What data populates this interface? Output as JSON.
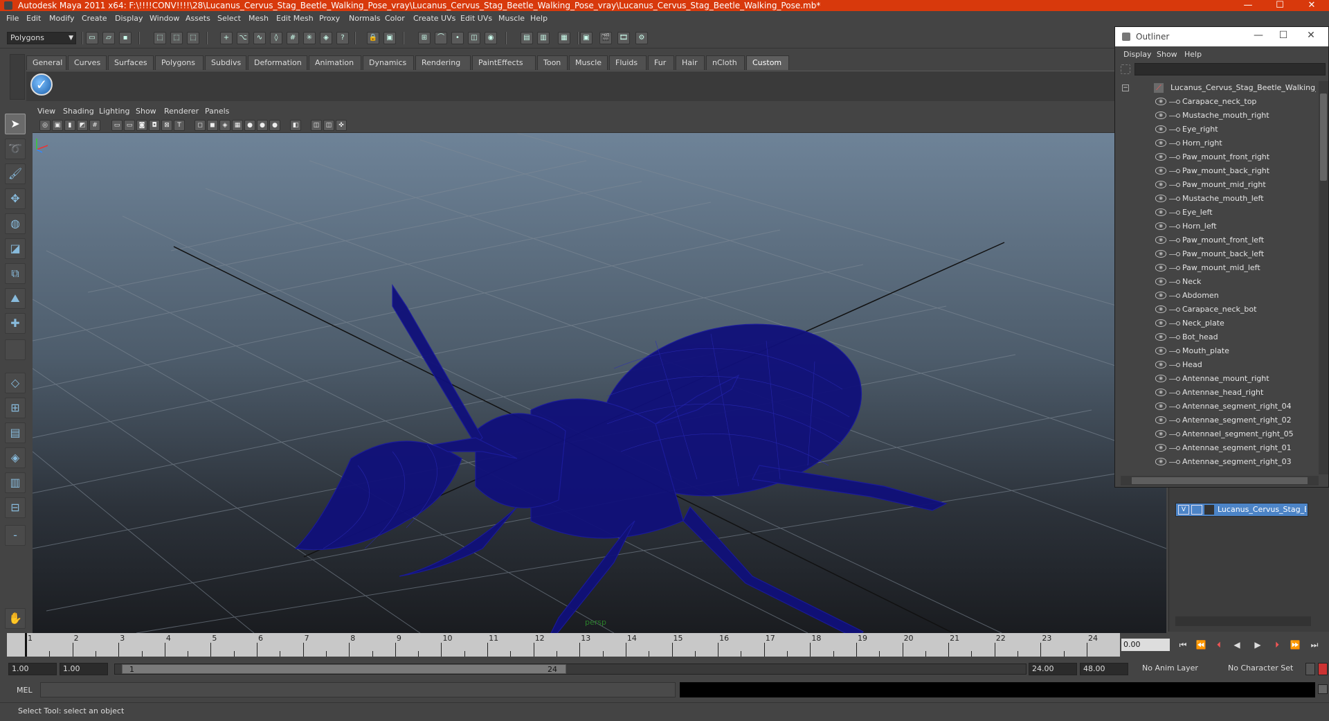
{
  "window": {
    "title": "Autodesk Maya 2011 x64: F:\\!!!!CONV!!!!\\28\\Lucanus_Cervus_Stag_Beetle_Walking_Pose_vray\\Lucanus_Cervus_Stag_Beetle_Walking_Pose_vray\\Lucanus_Cervus_Stag_Beetle_Walking_Pose.mb*",
    "minimize": "—",
    "maximize": "☐",
    "close": "✕"
  },
  "menu": [
    "File",
    "Edit",
    "Modify",
    "Create",
    "Display",
    "Window",
    "Assets",
    "Select",
    "Mesh",
    "Edit Mesh",
    "Proxy",
    "Normals",
    "Color",
    "Create UVs",
    "Edit UVs",
    "Muscle",
    "Help"
  ],
  "status": {
    "mode_selector": "Polygons"
  },
  "shelf": {
    "tabs": [
      "General",
      "Curves",
      "Surfaces",
      "Polygons",
      "Subdivs",
      "Deformation",
      "Animation",
      "Dynamics",
      "Rendering",
      "PaintEffects",
      "Toon",
      "Muscle",
      "Fluids",
      "Fur",
      "Hair",
      "nCloth",
      "Custom"
    ],
    "active_tab": "Custom"
  },
  "panel_menu": [
    "View",
    "Shading",
    "Lighting",
    "Show",
    "Renderer",
    "Panels"
  ],
  "viewport": {
    "camera_label": "persp",
    "wire_color": "#0d0d7a"
  },
  "outliner": {
    "title": "Outliner",
    "menu": [
      "Display",
      "Show",
      "Help"
    ],
    "root": "Lucanus_Cervus_Stag_Beetle_Walking_Pose",
    "items": [
      "Carapace_neck_top",
      "Mustache_mouth_right",
      "Eye_right",
      "Horn_right",
      "Paw_mount_front_right",
      "Paw_mount_back_right",
      "Paw_mount_mid_right",
      "Mustache_mouth_left",
      "Eye_left",
      "Horn_left",
      "Paw_mount_front_left",
      "Paw_mount_back_left",
      "Paw_mount_mid_left",
      "Neck",
      "Abdomen",
      "Carapace_neck_bot",
      "Neck_plate",
      "Bot_head",
      "Mouth_plate",
      "Head",
      "Antennae_mount_right",
      "Antennae_head_right",
      "Antennae_segment_right_04",
      "Antennae_segment_right_02",
      "Antennael_segment_right_05",
      "Antennae_segment_right_01",
      "Antennae_segment_right_03"
    ]
  },
  "layer": {
    "visible_flag": "V",
    "name": "Lucanus_Cervus_Stag_Beetle_Walking_Pose"
  },
  "timeline": {
    "ticks": [
      1,
      2,
      3,
      4,
      5,
      6,
      7,
      8,
      9,
      10,
      11,
      12,
      13,
      14,
      15,
      16,
      17,
      18,
      19,
      20,
      21,
      22,
      23,
      24
    ],
    "current_time": "0.00"
  },
  "range": {
    "start": "1.00",
    "playback_start": "1.00",
    "slider_start": "1",
    "slider_end": "24",
    "playback_end": "24.00",
    "end": "48.00",
    "anim_layer": "No Anim Layer",
    "character_set": "No Character Set"
  },
  "command": {
    "label": "MEL"
  },
  "help": {
    "text": "Select Tool: select an object"
  }
}
